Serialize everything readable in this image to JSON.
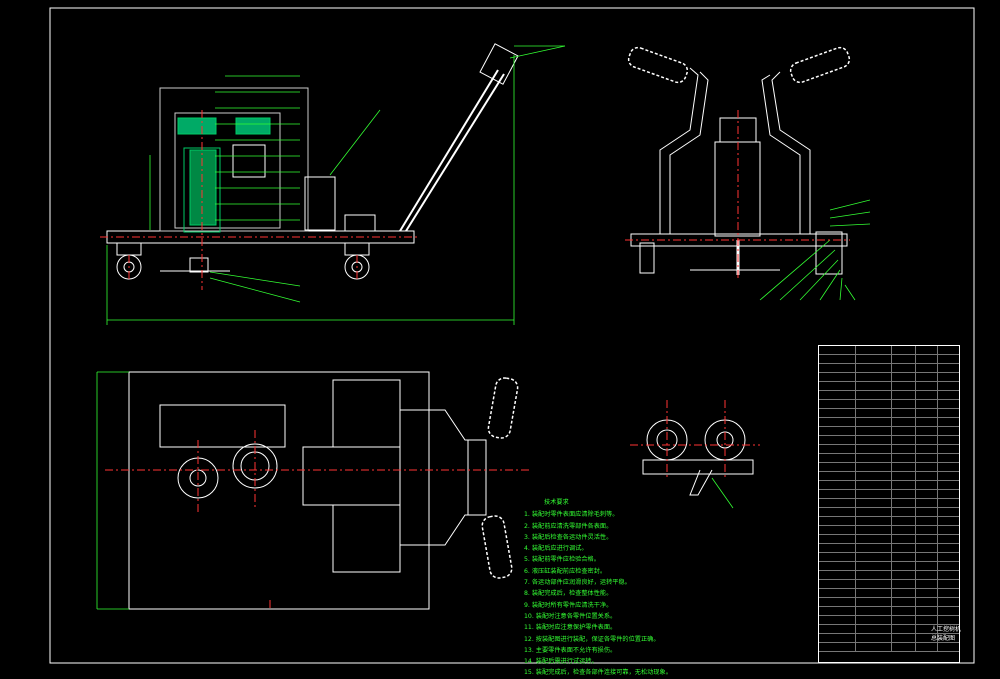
{
  "drawing": {
    "tech_notes": {
      "title": "技术要求",
      "lines": [
        "1. 装配时零件表面应清除毛刺等。",
        "2. 装配前应清洗零部件各表面。",
        "3. 装配后检查各运动件灵活性。",
        "4. 装配后应进行调试。",
        "5. 装配前零件应检验合格。",
        "6. 液压缸装配前应检查密封。",
        "7. 各运动部件应润滑良好，运转平稳。",
        "8. 装配完成后，检查整体性能。",
        "9. 装配时所有零件应清洗干净。",
        "10. 装配时注意各零件位置关系。",
        "11. 装配时应注意保护零件表面。",
        "12. 按装配图进行装配，保证各零件的位置正确。",
        "13. 主要零件表面不允许有损伤。",
        "14. 装配后需进行试运转。",
        "15. 装配完成后，检查各部件连接可靠，无松动现象。"
      ]
    },
    "title_block": {
      "name_line1": "人工挖树机",
      "name_line2": "总装配图"
    },
    "colors": {
      "border": "#ffffff",
      "outline": "#ffffff",
      "hatch": "#00cc33",
      "center": "#ff3333",
      "dimension": "#33ff33",
      "pipe": "#ff44aa"
    }
  }
}
